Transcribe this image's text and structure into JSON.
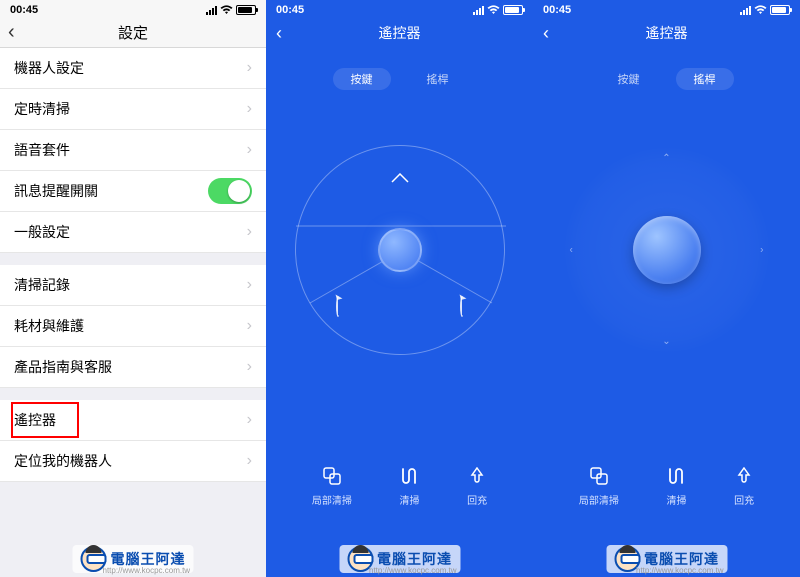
{
  "status": {
    "time": "00:45"
  },
  "settings": {
    "title": "設定",
    "group1": [
      {
        "label": "機器人設定"
      },
      {
        "label": "定時清掃"
      },
      {
        "label": "語音套件"
      },
      {
        "label": "訊息提醒開關",
        "toggle": true
      },
      {
        "label": "一般設定"
      }
    ],
    "group2": [
      {
        "label": "清掃記錄"
      },
      {
        "label": "耗材與維護"
      },
      {
        "label": "產品指南與客服"
      }
    ],
    "group3": [
      {
        "label": "遙控器",
        "highlighted": true
      },
      {
        "label": "定位我的機器人"
      }
    ]
  },
  "remote": {
    "title": "遙控器",
    "tabs": {
      "buttons": "按鍵",
      "joystick": "搖桿"
    },
    "actions": {
      "spot": "局部清掃",
      "clean": "清掃",
      "dock": "回充"
    }
  },
  "watermark": {
    "text": "電腦王阿達",
    "url": "http://www.kocpc.com.tw"
  }
}
